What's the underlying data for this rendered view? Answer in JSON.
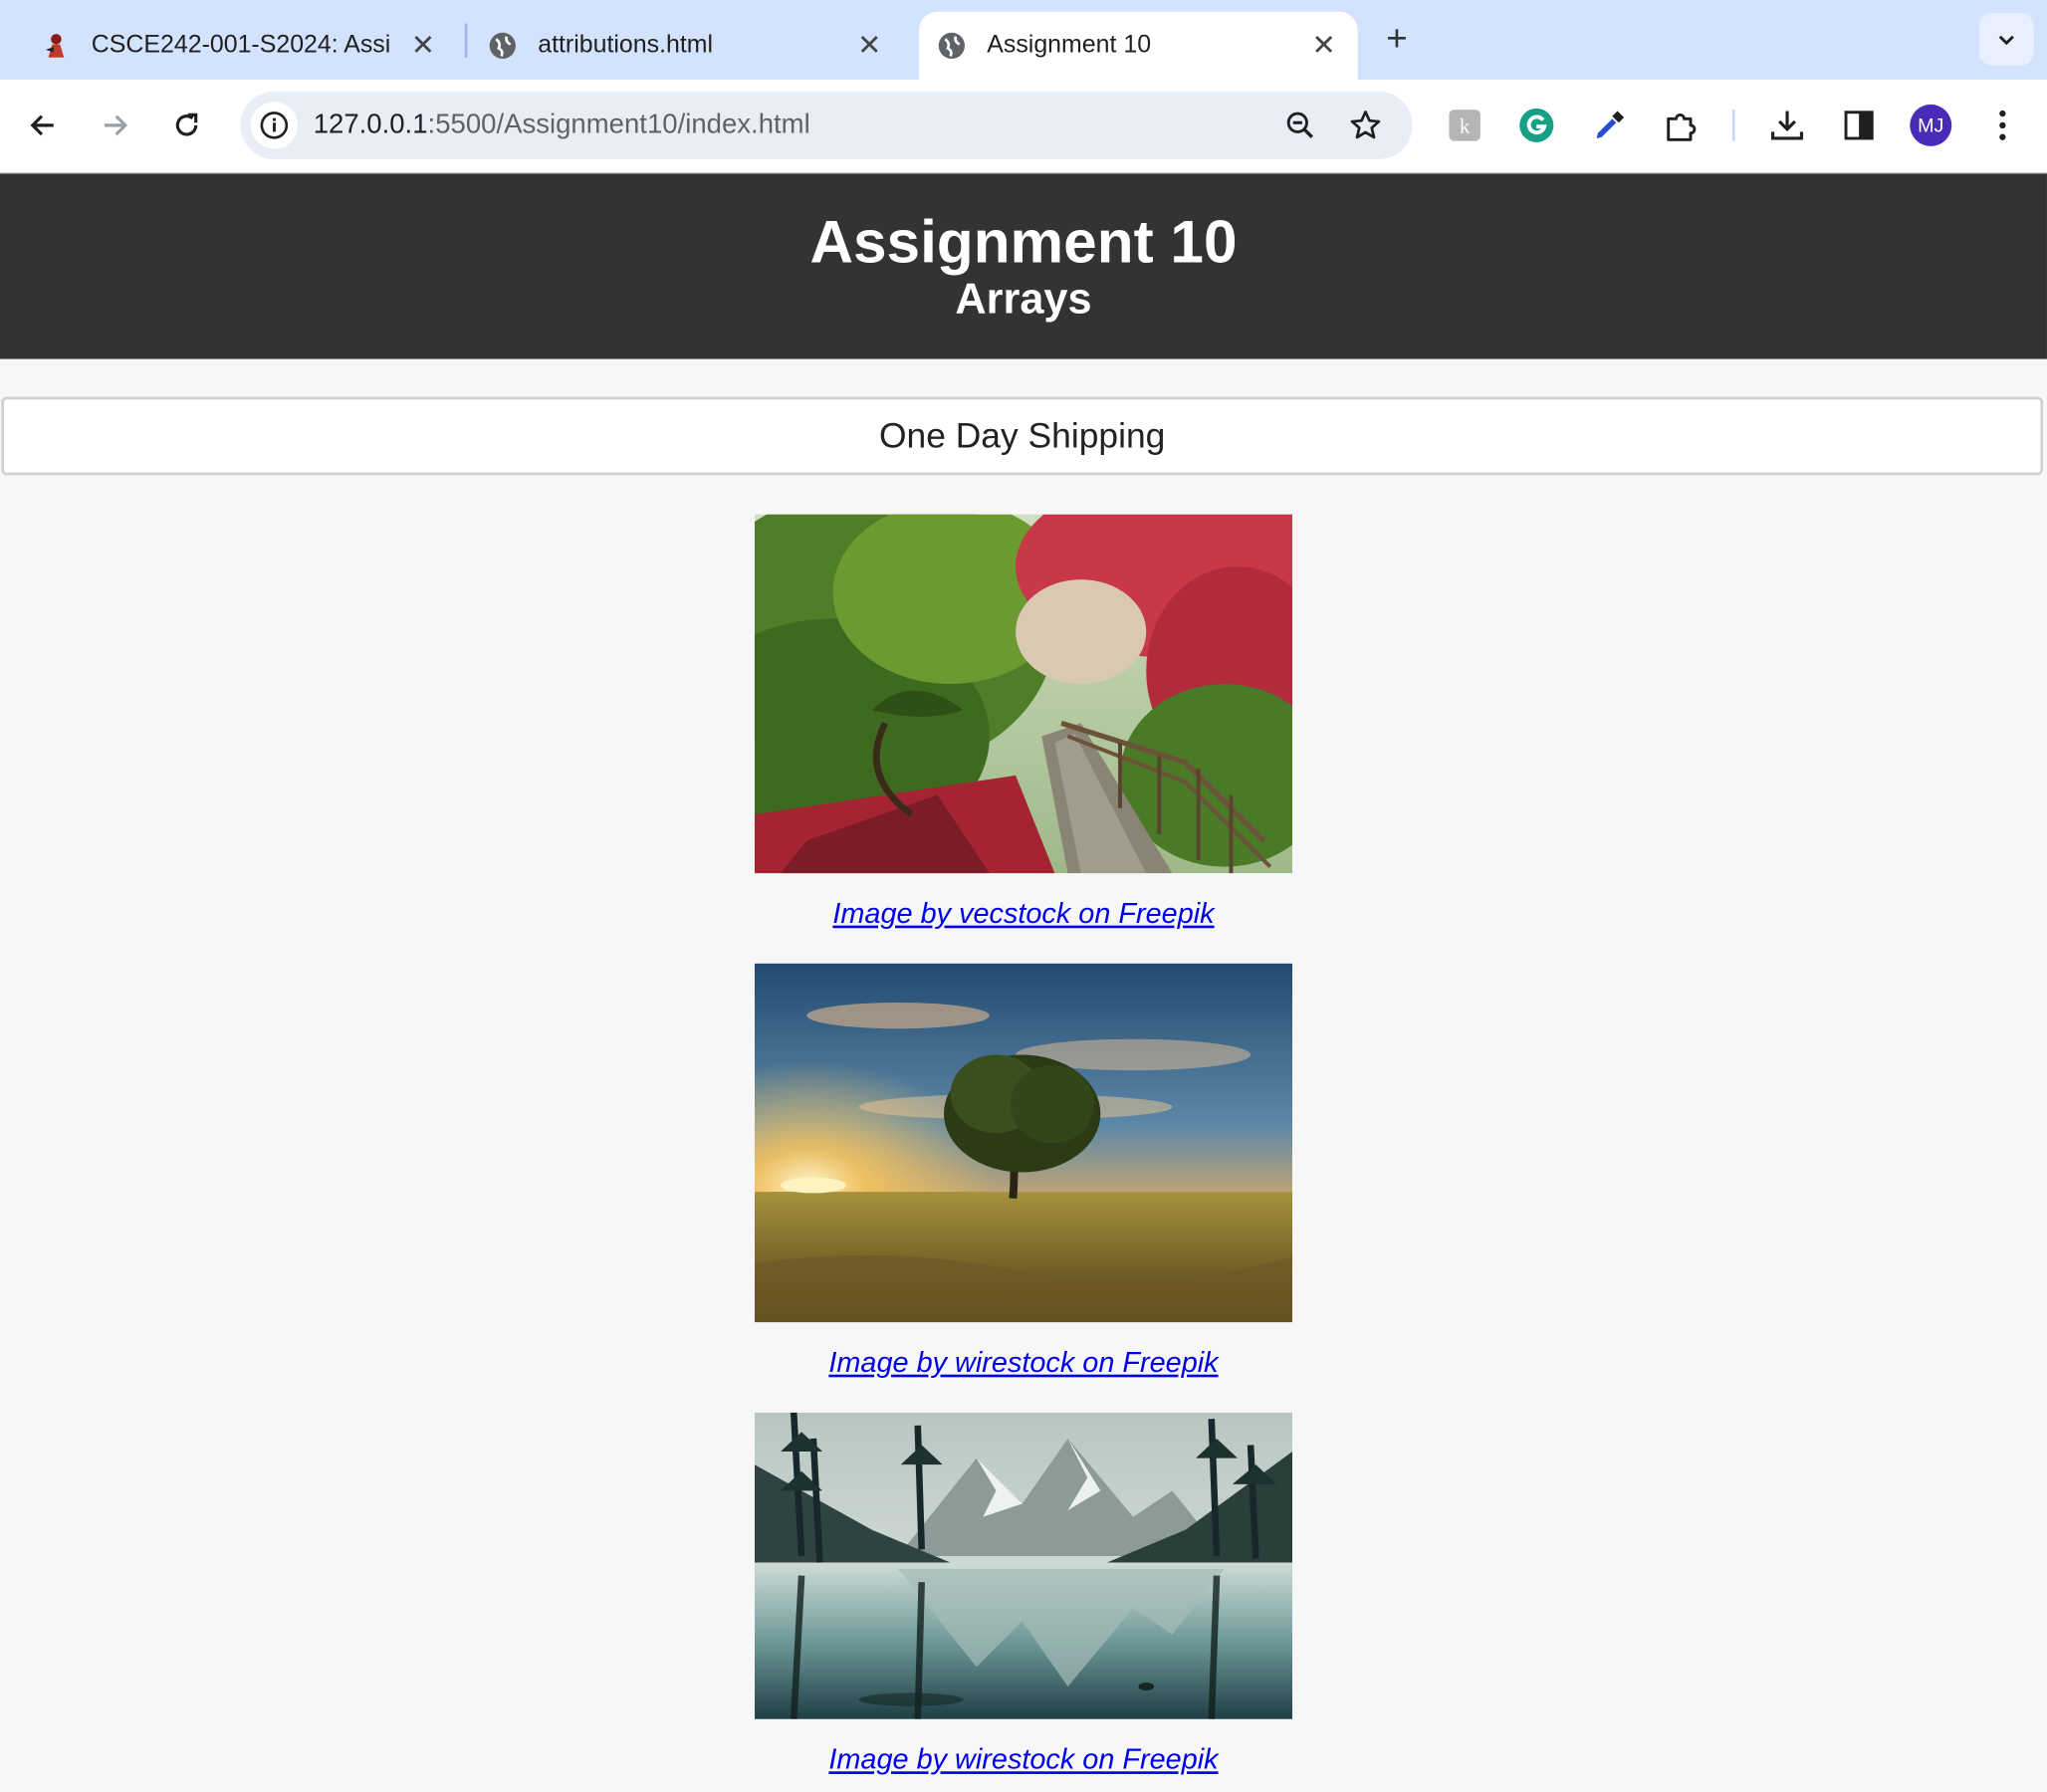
{
  "browser": {
    "tabs": [
      {
        "label": "CSCE242-001-S2024: Assi",
        "active": false,
        "favicon": "course-site-icon"
      },
      {
        "label": "attributions.html",
        "active": false,
        "favicon": "globe-icon"
      },
      {
        "label": "Assignment 10",
        "active": true,
        "favicon": "globe-icon"
      }
    ],
    "url_host": "127.0.0.1",
    "url_path": ":5500/Assignment10/index.html",
    "profile_initials": "MJ",
    "colors": {
      "tabstrip": "#d3e3fd",
      "avatar": "#4a2bb8"
    }
  },
  "page": {
    "title": "Assignment 10",
    "subtitle": "Arrays",
    "shipping_button": "One Day Shipping",
    "images": [
      {
        "caption": "Image by vecstock on Freepik",
        "alt": "autumn garden path"
      },
      {
        "caption": "Image by wirestock on Freepik",
        "alt": "tree at sunset"
      },
      {
        "caption": "Image by wirestock on Freepik",
        "alt": "mountain lake reflection"
      }
    ],
    "colors": {
      "header_bg": "#333333",
      "link": "#0000ee"
    }
  }
}
